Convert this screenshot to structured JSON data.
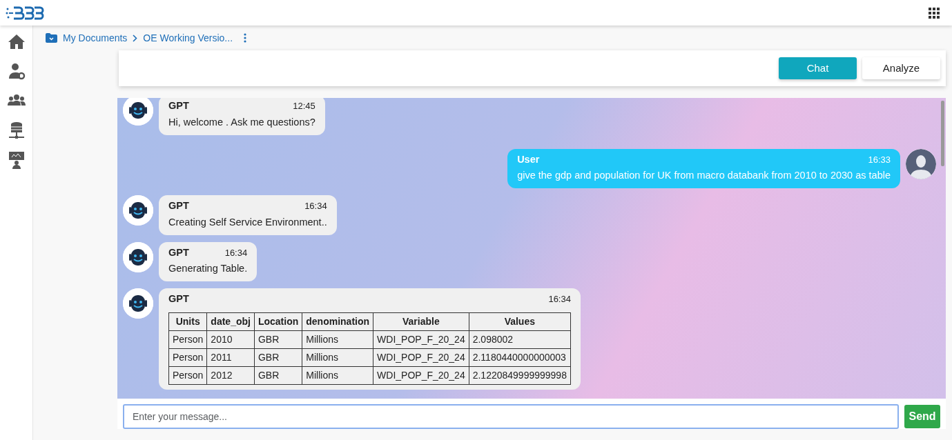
{
  "breadcrumb": [
    {
      "label": "My Documents"
    },
    {
      "label": "OE Working Versio..."
    }
  ],
  "mode_buttons": [
    {
      "label": "Chat",
      "selected": true
    },
    {
      "label": "Analyze",
      "selected": false
    }
  ],
  "messages": [
    {
      "kind": "bot",
      "sender": "GPT",
      "time": "12:45",
      "text": "Hi, welcome . Ask me questions?"
    },
    {
      "kind": "user",
      "sender": "User",
      "time": "16:33",
      "text": "give the gdp and population for UK from macro databank from 2010 to 2030 as table"
    },
    {
      "kind": "bot",
      "sender": "GPT",
      "time": "16:34",
      "text": "Creating Self Service Environment.."
    },
    {
      "kind": "bot",
      "sender": "GPT",
      "time": "16:34",
      "text": "Generating Table."
    },
    {
      "kind": "table",
      "sender": "GPT",
      "time": "16:34",
      "table": {
        "columns": [
          "Units",
          "date_obj",
          "Location",
          "denomination",
          "Variable",
          "Values"
        ],
        "rows": [
          [
            "Person",
            "2010",
            "GBR",
            "Millions",
            "WDI_POP_F_20_24",
            "2.098002"
          ],
          [
            "Person",
            "2011",
            "GBR",
            "Millions",
            "WDI_POP_F_20_24",
            "2.1180440000000003"
          ],
          [
            "Person",
            "2012",
            "GBR",
            "Millions",
            "WDI_POP_F_20_24",
            "2.1220849999999998"
          ]
        ]
      }
    }
  ],
  "composer": {
    "placeholder": "Enter your message...",
    "send": "Send"
  }
}
